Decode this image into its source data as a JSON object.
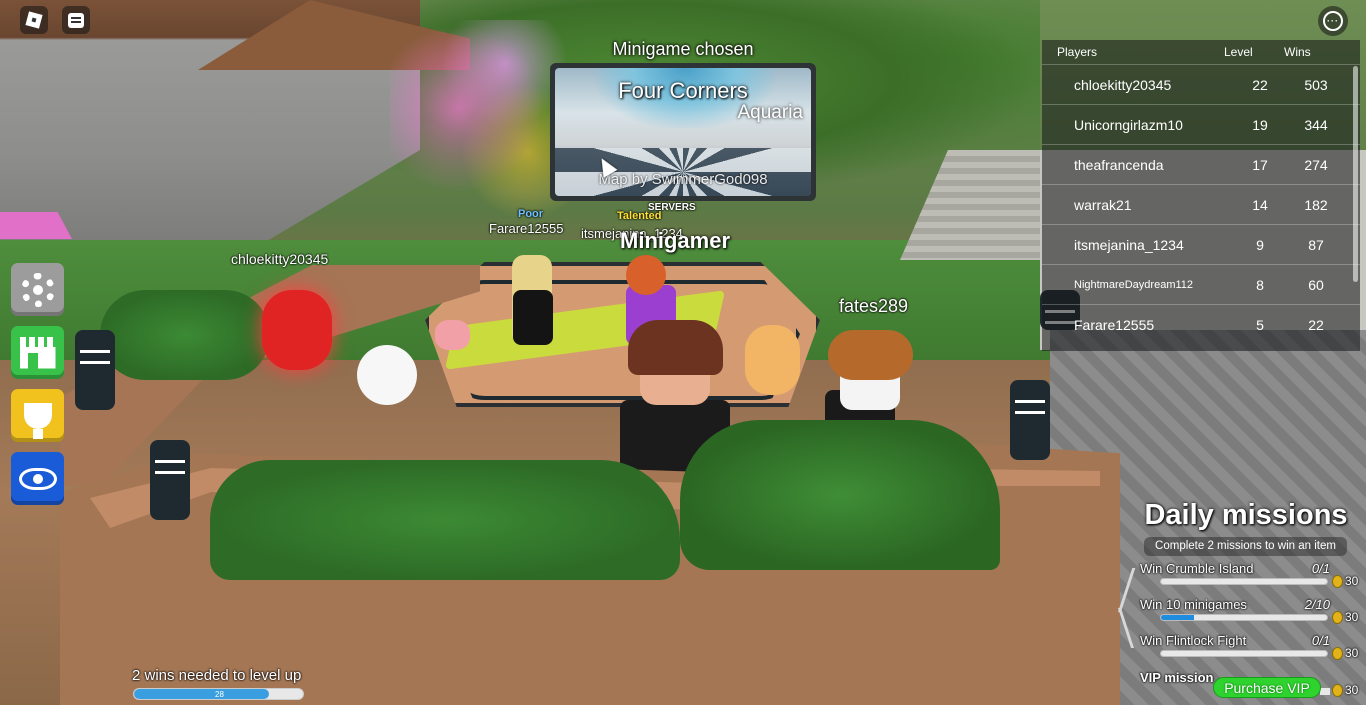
{
  "colors": {
    "settings": "#9c9c9c",
    "shop": "#38c24a",
    "trophy": "#f1c21e",
    "spectate": "#1a5bd8",
    "progress": "#3a9fe0",
    "vip_button": "#2ed32e",
    "coin": "#e2b219"
  },
  "top_bar": {
    "roblox_icon": "roblox-logo-icon",
    "chat_icon": "chat-icon",
    "menu_icon": "more-options-icon"
  },
  "side_menu": [
    {
      "icon": "gear-icon",
      "name": "settings"
    },
    {
      "icon": "shop-icon",
      "name": "shop"
    },
    {
      "icon": "trophy-icon",
      "name": "trophies"
    },
    {
      "icon": "eye-icon",
      "name": "spectate"
    }
  ],
  "minigame": {
    "heading": "Minigame chosen",
    "name": "Four Corners",
    "map": "Aquaria",
    "credit": "Map by SwimmerGod098"
  },
  "world_labels": {
    "chloekitty": "chloekitty20345",
    "fates": "fates289",
    "minigamer": "Minigamer",
    "farare": "Farare12555",
    "itsmejanina": "itsmejanina_1234",
    "talented": "Talented",
    "poor": "Poor",
    "servers": "SERVERS"
  },
  "leaderboard": {
    "headers": {
      "players": "Players",
      "level": "Level",
      "wins": "Wins"
    },
    "rows": [
      {
        "name": "chloekitty20345",
        "level": "22",
        "wins": "503"
      },
      {
        "name": "Unicorngirlazm10",
        "level": "19",
        "wins": "344"
      },
      {
        "name": "theafrancenda",
        "level": "17",
        "wins": "274"
      },
      {
        "name": "warrak21",
        "level": "14",
        "wins": "182"
      },
      {
        "name": "itsmejanina_1234",
        "level": "9",
        "wins": "87"
      },
      {
        "name": "NightmareDaydream112",
        "level": "8",
        "wins": "60"
      },
      {
        "name": "Farare12555",
        "level": "5",
        "wins": "22"
      }
    ]
  },
  "daily_missions": {
    "title": "Daily missions",
    "subtitle": "Complete 2 missions to win an item",
    "missions": [
      {
        "name": "Win Crumble Island",
        "progress": "0/1",
        "fraction": 0.0,
        "reward": "30"
      },
      {
        "name": "Win 10 minigames",
        "progress": "2/10",
        "fraction": 0.2,
        "reward": "30"
      },
      {
        "name": "Win Flintlock Fight",
        "progress": "0/1",
        "fraction": 0.0,
        "reward": "30"
      }
    ],
    "vip": {
      "label": "VIP mission",
      "button": "Purchase VIP",
      "reward": "30"
    }
  },
  "level": {
    "text": "2 wins needed to level up",
    "value": "28",
    "fraction": 0.8
  }
}
